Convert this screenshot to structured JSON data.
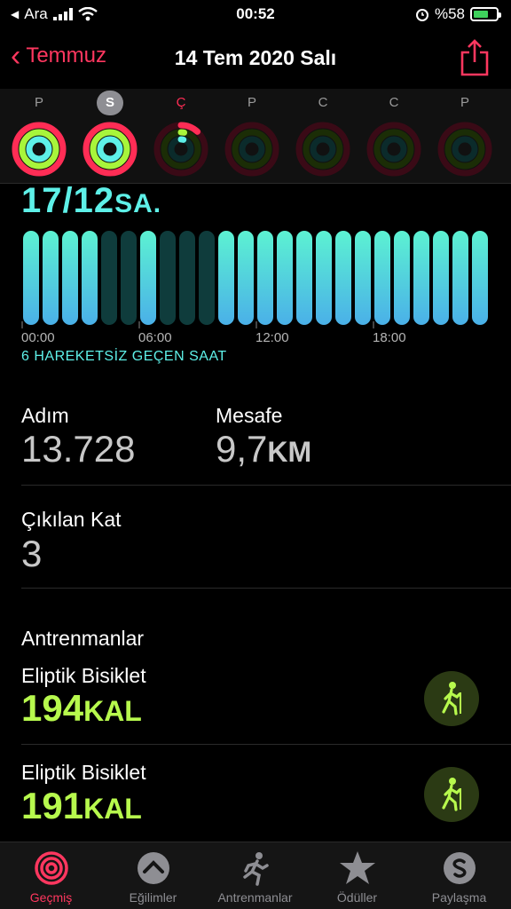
{
  "status_bar": {
    "carrier": "Ara",
    "time": "00:52",
    "battery": "%58"
  },
  "nav": {
    "back_label": "Temmuz",
    "title": "14 Tem 2020 Salı"
  },
  "week": [
    {
      "letter": "P",
      "state": "full"
    },
    {
      "letter": "S",
      "state": "selected"
    },
    {
      "letter": "Ç",
      "state": "today"
    },
    {
      "letter": "P",
      "state": "empty"
    },
    {
      "letter": "C",
      "state": "empty"
    },
    {
      "letter": "C",
      "state": "empty"
    },
    {
      "letter": "P",
      "state": "empty"
    }
  ],
  "stand": {
    "value": "17/12",
    "unit": "SA.",
    "hours_active": [
      1,
      1,
      1,
      1,
      0,
      0,
      1,
      0,
      0,
      0,
      1,
      1,
      1,
      1,
      1,
      1,
      1,
      1,
      1,
      1,
      1,
      1,
      1,
      1
    ],
    "axis_labels": [
      "00:00",
      "06:00",
      "12:00",
      "18:00"
    ],
    "inactive_text": "6 HAREKETSİZ GEÇEN SAAT"
  },
  "stats": {
    "steps_label": "Adım",
    "steps_value": "13.728",
    "distance_label": "Mesafe",
    "distance_value": "9,7",
    "distance_unit": "KM",
    "floors_label": "Çıkılan Kat",
    "floors_value": "3"
  },
  "workouts": {
    "section_title": "Antrenmanlar",
    "items": [
      {
        "name": "Eliptik Bisiklet",
        "value": "194",
        "unit": "KAL"
      },
      {
        "name": "Eliptik Bisiklet",
        "value": "191",
        "unit": "KAL"
      }
    ]
  },
  "tabs": [
    {
      "label": "Geçmiş",
      "icon": "history-rings-icon",
      "active": true
    },
    {
      "label": "Eğilimler",
      "icon": "trends-icon",
      "active": false
    },
    {
      "label": "Antrenmanlar",
      "icon": "running-figure-icon",
      "active": false
    },
    {
      "label": "Ödüller",
      "icon": "award-star-icon",
      "active": false
    },
    {
      "label": "Paylaşma",
      "icon": "sharing-icon",
      "active": false
    }
  ],
  "colors": {
    "accent": "#ff375f",
    "stand": "#5ef0e8",
    "calories": "#b7f94d",
    "move": "#ff2d55",
    "exercise": "#a8f53b"
  }
}
